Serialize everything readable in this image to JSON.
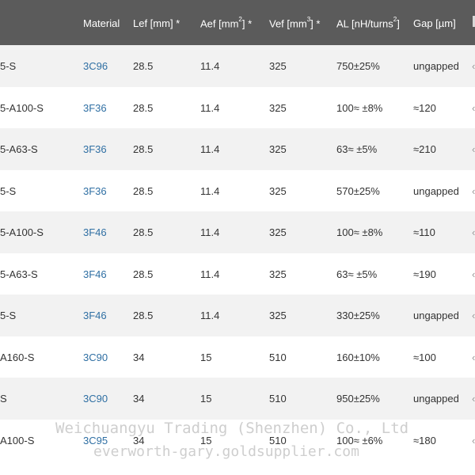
{
  "table": {
    "columns": [
      {
        "label": "Material"
      },
      {
        "label": "Lef [mm] *"
      },
      {
        "label_pre": "Aef [mm",
        "label_sup": "2",
        "label_post": "] *"
      },
      {
        "label_pre": "Vef [mm",
        "label_sup": "3",
        "label_post": "] *"
      },
      {
        "label_pre": "AL [nH/turns",
        "label_sup": "2",
        "label_post": "]"
      },
      {
        "label": "Gap [µm]"
      }
    ],
    "rows": [
      {
        "type": "5-S",
        "material": "3C96",
        "lef": "28.5",
        "aef": "11.4",
        "vef": "325",
        "al": "750±25%",
        "gap": "ungapped"
      },
      {
        "type": "5-A100-S",
        "material": "3F36",
        "lef": "28.5",
        "aef": "11.4",
        "vef": "325",
        "al": "100≈ ±8%",
        "gap": "≈120"
      },
      {
        "type": "5-A63-S",
        "material": "3F36",
        "lef": "28.5",
        "aef": "11.4",
        "vef": "325",
        "al": "63≈ ±5%",
        "gap": "≈210"
      },
      {
        "type": "5-S",
        "material": "3F36",
        "lef": "28.5",
        "aef": "11.4",
        "vef": "325",
        "al": "570±25%",
        "gap": "ungapped"
      },
      {
        "type": "5-A100-S",
        "material": "3F46",
        "lef": "28.5",
        "aef": "11.4",
        "vef": "325",
        "al": "100≈ ±8%",
        "gap": "≈110"
      },
      {
        "type": "5-A63-S",
        "material": "3F46",
        "lef": "28.5",
        "aef": "11.4",
        "vef": "325",
        "al": "63≈ ±5%",
        "gap": "≈190"
      },
      {
        "type": "5-S",
        "material": "3F46",
        "lef": "28.5",
        "aef": "11.4",
        "vef": "325",
        "al": "330±25%",
        "gap": "ungapped"
      },
      {
        "type": "A160-S",
        "material": "3C90",
        "lef": "34",
        "aef": "15",
        "vef": "510",
        "al": "160±10%",
        "gap": "≈100"
      },
      {
        "type": "S",
        "material": "3C90",
        "lef": "34",
        "aef": "15",
        "vef": "510",
        "al": "950±25%",
        "gap": "ungapped"
      },
      {
        "type": "A100-S",
        "material": "3C95",
        "lef": "34",
        "aef": "15",
        "vef": "510",
        "al": "100≈ ±6%",
        "gap": "≈180"
      }
    ],
    "edge_glyph": "‹"
  },
  "watermark": {
    "line1": "Weichuangyu Trading (Shenzhen) Co., Ltd",
    "line2": "everworth-gary.goldsupplier.com"
  },
  "colors": {
    "header_bg": "#5b5b5b",
    "row_alt_bg": "#f2f2f2",
    "link": "#2f6fa3"
  }
}
